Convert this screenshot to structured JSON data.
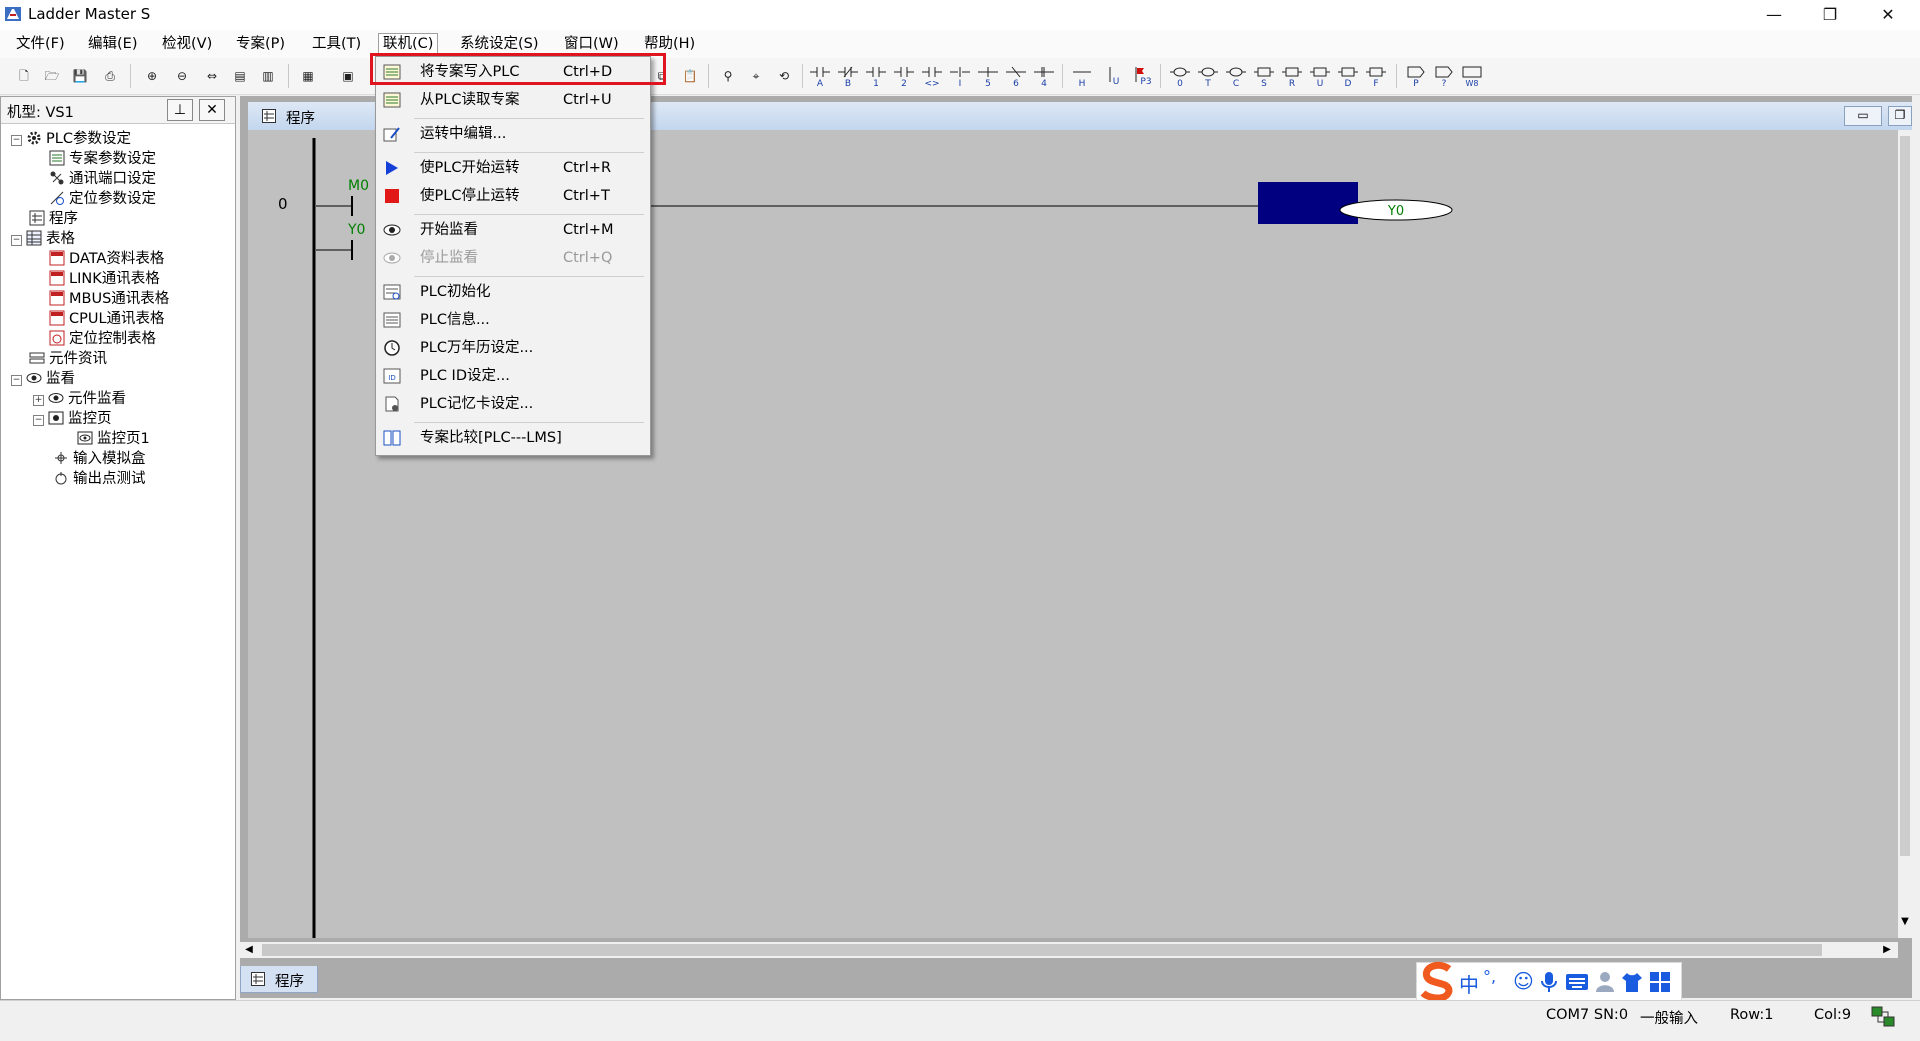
{
  "window": {
    "title": "Ladder Master S",
    "controls": [
      "minimize",
      "restore",
      "close"
    ]
  },
  "menubar": {
    "items": [
      {
        "label": "文件(F)"
      },
      {
        "label": "编辑(E)"
      },
      {
        "label": "检视(V)"
      },
      {
        "label": "专案(P)"
      },
      {
        "label": "工具(T)"
      },
      {
        "label": "联机(C)",
        "open": true
      },
      {
        "label": "系统设定(S)"
      },
      {
        "label": "窗口(W)"
      },
      {
        "label": "帮助(H)"
      }
    ]
  },
  "toolbar": {
    "contact_labels": [
      "A",
      "B",
      "1",
      "2",
      "<>",
      "I",
      "5",
      "6",
      "4"
    ],
    "extra_labels": [
      "H",
      "U",
      "P3"
    ],
    "coil_labels": [
      "0",
      "T",
      "C",
      "S",
      "R",
      "U",
      "D",
      "F"
    ],
    "tail_labels": [
      "P",
      "?",
      "W8"
    ]
  },
  "left_panel": {
    "title": "机型: VS1",
    "pin_glyph": "⊥",
    "close_glyph": "✕",
    "tree": [
      {
        "label": "PLC参数设定",
        "icon": "gear-icon"
      },
      {
        "label": "专案参数设定",
        "icon": "project-settings-icon"
      },
      {
        "label": "通讯端口设定",
        "icon": "port-icon"
      },
      {
        "label": "定位参数设定",
        "icon": "position-icon"
      },
      {
        "label": "程序",
        "icon": "program-icon"
      },
      {
        "label": "表格",
        "icon": "table-icon"
      },
      {
        "label": "DATA资料表格",
        "icon": "data-table-icon"
      },
      {
        "label": "LINK通讯表格",
        "icon": "link-table-icon"
      },
      {
        "label": "MBUS通讯表格",
        "icon": "mbus-table-icon"
      },
      {
        "label": "CPUL通讯表格",
        "icon": "cpul-table-icon"
      },
      {
        "label": "定位控制表格",
        "icon": "position-table-icon"
      },
      {
        "label": "元件资讯",
        "icon": "component-info-icon"
      },
      {
        "label": "监看",
        "icon": "eye-icon"
      },
      {
        "label": "元件监看",
        "icon": "eye-icon"
      },
      {
        "label": "监控页",
        "icon": "monitor-page-icon"
      },
      {
        "label": "监控页1",
        "icon": "eye-icon"
      },
      {
        "label": "输入模拟盒",
        "icon": "input-sim-icon"
      },
      {
        "label": "输出点测试",
        "icon": "output-test-icon"
      }
    ]
  },
  "document": {
    "title": "程序",
    "tab_label": "程序",
    "rung_number": "0",
    "contacts": [
      "M0",
      "Y0"
    ],
    "coil_label": "Y0",
    "colors": {
      "ladder_bg": "#c0c0c0",
      "highlight_block": "#000080",
      "contact_label": "#008000"
    }
  },
  "dropdown": {
    "items": [
      {
        "label": "将专案写入PLC",
        "shortcut": "Ctrl+D",
        "icon": "write-plc-icon",
        "highlighted": true
      },
      {
        "label": "从PLC读取专案",
        "shortcut": "Ctrl+U",
        "icon": "read-plc-icon"
      },
      {
        "label": "运转中编辑...",
        "shortcut": "",
        "icon": "run-edit-icon"
      },
      {
        "label": "使PLC开始运转",
        "shortcut": "Ctrl+R",
        "icon": "play-icon"
      },
      {
        "label": "使PLC停止运转",
        "shortcut": "Ctrl+T",
        "icon": "stop-icon"
      },
      {
        "label": "开始监看",
        "shortcut": "Ctrl+M",
        "icon": "eye-icon"
      },
      {
        "label": "停止监看",
        "shortcut": "Ctrl+Q",
        "icon": "eye-disabled-icon",
        "disabled": true
      },
      {
        "label": "PLC初始化",
        "shortcut": "",
        "icon": "plc-init-icon"
      },
      {
        "label": "PLC信息...",
        "shortcut": "",
        "icon": "plc-info-icon"
      },
      {
        "label": "PLC万年历设定...",
        "shortcut": "",
        "icon": "clock-icon"
      },
      {
        "label": "PLC ID设定...",
        "shortcut": "",
        "icon": "plc-id-icon"
      },
      {
        "label": "PLC记忆卡设定...",
        "shortcut": "",
        "icon": "memory-card-icon"
      },
      {
        "label": "专案比较[PLC---LMS]",
        "shortcut": "",
        "icon": "compare-icon"
      }
    ],
    "highlight_color": "#e0141e"
  },
  "statusbar": {
    "port": "COM7 SN:0",
    "mode": "一般输入",
    "row": "Row:1",
    "col": "Col:9"
  },
  "ime": {
    "lang": "中",
    "punct": "°,"
  }
}
